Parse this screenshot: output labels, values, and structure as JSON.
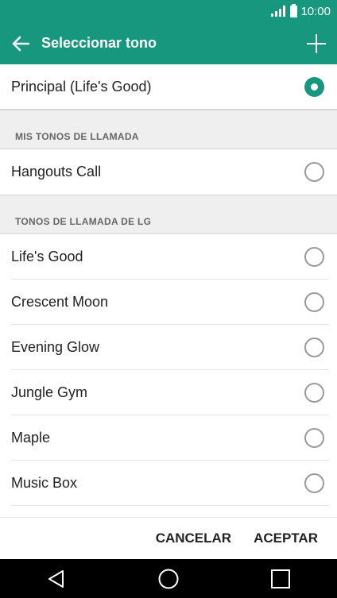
{
  "status_bar": {
    "time": "10:00"
  },
  "app_bar": {
    "title": "Seleccionar tono"
  },
  "current": {
    "label": "Principal (Life's Good)",
    "selected": true
  },
  "sections": [
    {
      "header": "MIS TONOS DE LLAMADA",
      "items": [
        {
          "label": "Hangouts Call",
          "selected": false
        }
      ]
    },
    {
      "header": "TONOS DE LLAMADA DE LG",
      "items": [
        {
          "label": "Life's Good",
          "selected": false
        },
        {
          "label": "Crescent Moon",
          "selected": false
        },
        {
          "label": "Evening Glow",
          "selected": false
        },
        {
          "label": "Jungle Gym",
          "selected": false
        },
        {
          "label": "Maple",
          "selected": false
        },
        {
          "label": "Music Box",
          "selected": false
        }
      ]
    }
  ],
  "actions": {
    "cancel": "CANCELAR",
    "accept": "ACEPTAR"
  },
  "colors": {
    "accent": "#17977e"
  }
}
